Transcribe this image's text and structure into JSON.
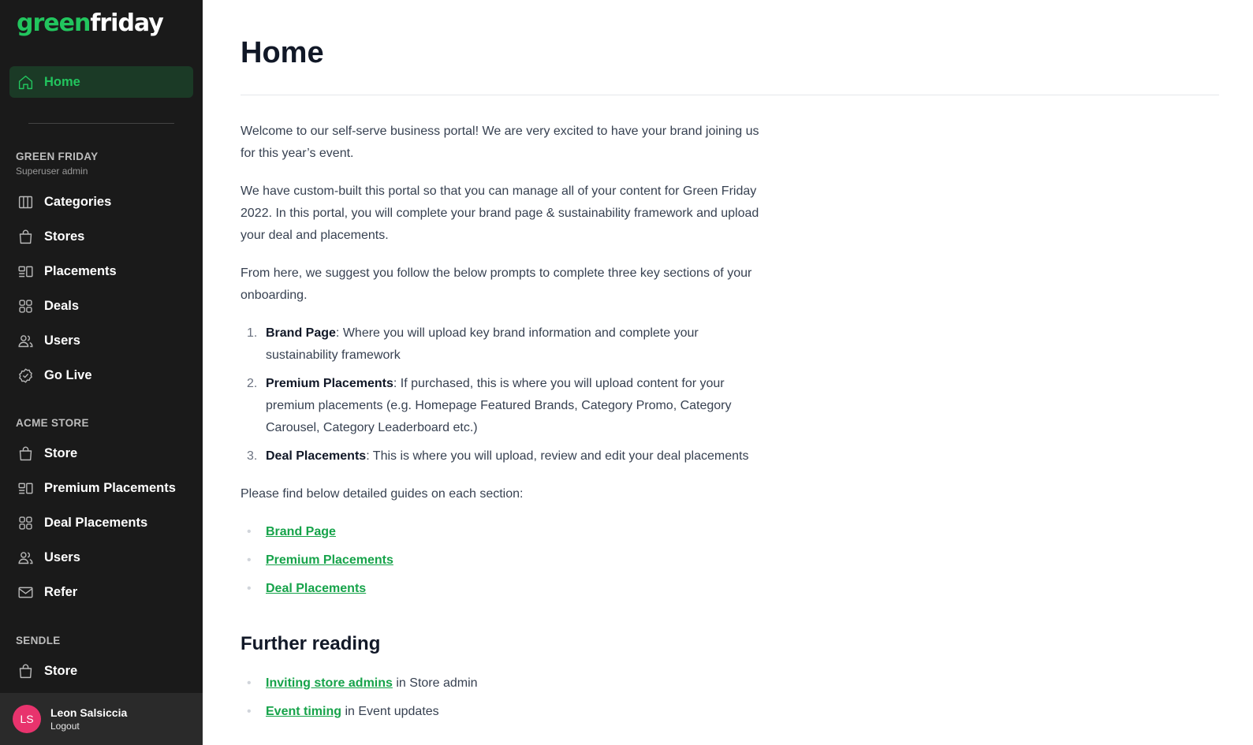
{
  "brand": {
    "part1": "green",
    "part2": "friday"
  },
  "nav": {
    "home": {
      "label": "Home",
      "icon": "home-icon"
    }
  },
  "sections": [
    {
      "title": "GREEN FRIDAY",
      "subtitle": "Superuser admin",
      "items": [
        {
          "label": "Categories",
          "icon": "columns-icon"
        },
        {
          "label": "Stores",
          "icon": "shopping-bag-icon"
        },
        {
          "label": "Placements",
          "icon": "placements-icon"
        },
        {
          "label": "Deals",
          "icon": "grid-icon"
        },
        {
          "label": "Users",
          "icon": "users-icon"
        },
        {
          "label": "Go Live",
          "icon": "check-badge-icon"
        }
      ]
    },
    {
      "title": "ACME STORE",
      "items": [
        {
          "label": "Store",
          "icon": "shopping-bag-icon"
        },
        {
          "label": "Premium Placements",
          "icon": "placements-icon"
        },
        {
          "label": "Deal Placements",
          "icon": "grid-icon"
        },
        {
          "label": "Users",
          "icon": "users-icon"
        },
        {
          "label": "Refer",
          "icon": "envelope-icon"
        }
      ]
    },
    {
      "title": "SENDLE",
      "items": [
        {
          "label": "Store",
          "icon": "shopping-bag-icon"
        }
      ]
    }
  ],
  "user": {
    "initials": "LS",
    "name": "Leon Salsiccia",
    "logout": "Logout"
  },
  "main": {
    "title": "Home",
    "intro_1": "Welcome to our self-serve business portal! We are very excited to have your brand joining us for this year’s event.",
    "intro_2": "We have custom-built this portal so that you can manage all of your content for Green Friday 2022. In this portal, you will complete your brand page & sustainability framework and upload your deal and placements.",
    "intro_3": "From here, we suggest you follow the below prompts to complete three key sections of your onboarding.",
    "steps": [
      {
        "num": "1.",
        "title": "Brand Page",
        "text": ": Where you will upload key brand information and complete your sustainability framework"
      },
      {
        "num": "2.",
        "title": "Premium Placements",
        "text": ": If purchased, this is where you will upload content for your premium placements (e.g. Homepage Featured Brands, Category Promo, Category Carousel, Category Leaderboard etc.)"
      },
      {
        "num": "3.",
        "title": "Deal Placements",
        "text": ": This is where you will upload, review and edit your deal placements"
      }
    ],
    "guides_intro": "Please find below detailed guides on each section:",
    "guides": [
      "Brand Page",
      "Premium Placements",
      "Deal Placements"
    ],
    "further_title": "Further reading",
    "further": [
      {
        "link": "Inviting store admins",
        "suffix": " in Store admin"
      },
      {
        "link": "Event timing",
        "suffix": " in Event updates"
      }
    ]
  }
}
